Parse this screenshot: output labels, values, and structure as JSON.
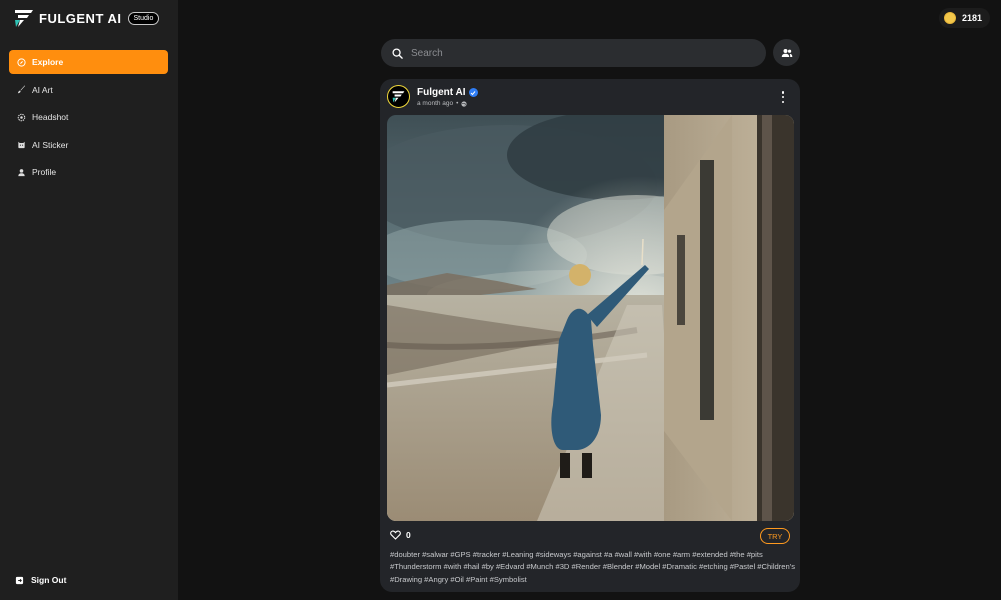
{
  "brand": {
    "name": "FULGENT AI",
    "badge": "Studio"
  },
  "sidebar": {
    "items": [
      {
        "label": "Explore",
        "icon": "compass-icon",
        "active": true
      },
      {
        "label": "AI Art",
        "icon": "brush-icon",
        "active": false
      },
      {
        "label": "Headshot",
        "icon": "headshot-icon",
        "active": false
      },
      {
        "label": "AI Sticker",
        "icon": "sticker-icon",
        "active": false
      },
      {
        "label": "Profile",
        "icon": "person-icon",
        "active": false
      }
    ],
    "signout_label": "Sign Out"
  },
  "coins": {
    "amount": "2181"
  },
  "search": {
    "placeholder": "Search"
  },
  "post": {
    "author": "Fulgent AI",
    "verified": true,
    "time": "a month ago",
    "likes": "0",
    "try_label": "TRY",
    "tags": "#doubter #salwar #GPS #tracker #Leaning #sideways #against #a #wall #with #one #arm #extended #the #pits #Thunderstorm #with #hail #by #Edvard #Munch #3D #Render #Blender #Model #Dramatic #etching #Pastel #Children's #Drawing #Angry #Oil #Paint #Symbolist"
  },
  "colors": {
    "accent": "#ff8e0e",
    "background": "#121212",
    "sidebar": "#1f1f1f",
    "card": "#232529",
    "verified": "#2f7ef6",
    "coin": "#f3c74b"
  }
}
